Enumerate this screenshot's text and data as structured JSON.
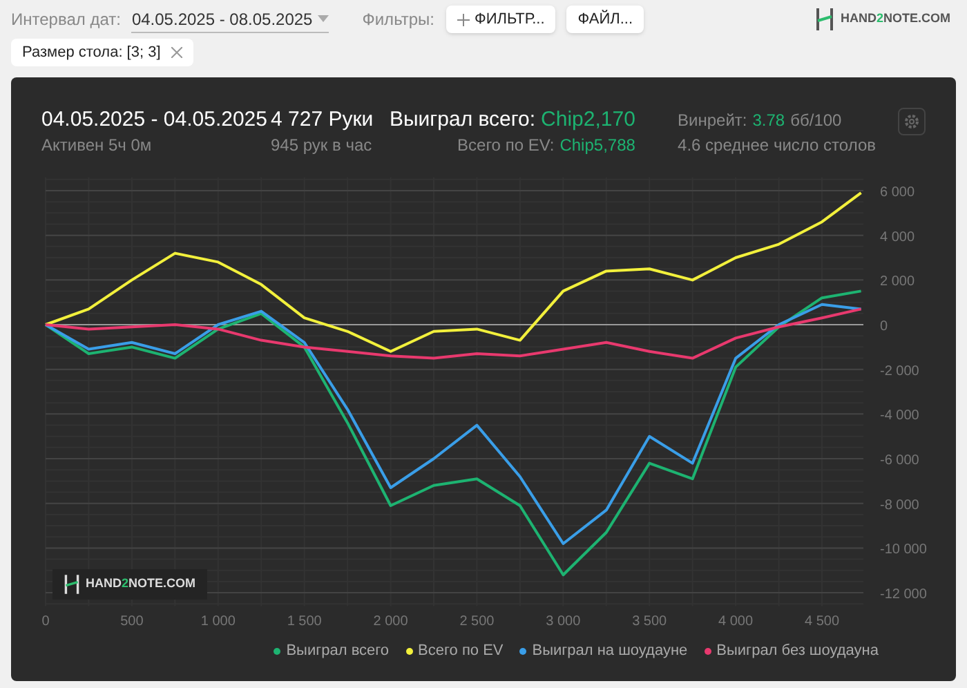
{
  "toolbar": {
    "date_label": "Интервал дат:",
    "date_value": "04.05.2025 - 08.05.2025",
    "filters_label": "Фильтры:",
    "filter_button": "ФИЛЬТР...",
    "file_button": "ФАЙЛ...",
    "logo": {
      "prefix": "HAND",
      "accent": "2",
      "suffix": "NOTE.COM"
    }
  },
  "active_filters": [
    {
      "label": "Размер стола: [3; 3]"
    }
  ],
  "summary": {
    "period": "04.05.2025 - 04.05.2025",
    "active": "Активен 5ч 0м",
    "hands": "4 727 Руки",
    "hands_per_hour": "945 рук в час",
    "won_label": "Выиграл всего:",
    "won_value": "Chip2,170",
    "ev_label": "Всего по EV:",
    "ev_value": "Chip5,788",
    "winrate_label": "Винрейт:",
    "winrate_value": "3.78",
    "winrate_unit": "бб/100",
    "tables": "4.6 среднее число столов"
  },
  "chart": {
    "logo": {
      "prefix": "HAND",
      "accent": "2",
      "suffix": "NOTE.COM"
    },
    "chart_data": {
      "type": "line",
      "x": [
        0,
        250,
        500,
        750,
        1000,
        1250,
        1500,
        1750,
        2000,
        2250,
        2500,
        2750,
        3000,
        3250,
        3500,
        3750,
        4000,
        4250,
        4500,
        4727
      ],
      "series": [
        {
          "name": "Выиграл всего",
          "color": "#1db371",
          "values": [
            0,
            -1300,
            -1000,
            -1500,
            -200,
            500,
            -1000,
            -4400,
            -8100,
            -7200,
            -6900,
            -8100,
            -11200,
            -9300,
            -6200,
            -6900,
            -1900,
            -100,
            1200,
            1500
          ]
        },
        {
          "name": "Всего по EV",
          "color": "#f2f03c",
          "values": [
            0,
            700,
            2000,
            3200,
            2800,
            1800,
            300,
            -300,
            -1200,
            -300,
            -200,
            -700,
            1500,
            2400,
            2500,
            2000,
            3000,
            3600,
            4600,
            5900
          ]
        },
        {
          "name": "Выиграл на шоудауне",
          "color": "#3a9ee8",
          "values": [
            0,
            -1100,
            -800,
            -1300,
            0,
            600,
            -800,
            -3800,
            -7300,
            -6000,
            -4500,
            -6800,
            -9800,
            -8300,
            -5000,
            -6200,
            -1500,
            0,
            900,
            700
          ]
        },
        {
          "name": "Выиграл без шоудауна",
          "color": "#e8396e",
          "values": [
            0,
            -200,
            -100,
            0,
            -200,
            -700,
            -1000,
            -1200,
            -1400,
            -1500,
            -1300,
            -1400,
            -1100,
            -800,
            -1200,
            -1500,
            -600,
            -100,
            300,
            700
          ]
        }
      ],
      "grid": true,
      "xlim": [
        0,
        4727
      ],
      "ylim": [
        -12600,
        6600
      ],
      "xticks": [
        0,
        500,
        {
          "value": 1000,
          "label": "1 000"
        },
        {
          "value": 1500,
          "label": "1 500"
        },
        {
          "value": 2000,
          "label": "2 000"
        },
        {
          "value": 2500,
          "label": "2 500"
        },
        {
          "value": 3000,
          "label": "3 000"
        },
        {
          "value": 3500,
          "label": "3 500"
        },
        {
          "value": 4000,
          "label": "4 000"
        },
        {
          "value": 4500,
          "label": "4 500"
        }
      ],
      "yticks": [
        {
          "value": 6000,
          "label": "6 000"
        },
        {
          "value": 4000,
          "label": "4 000"
        },
        {
          "value": 2000,
          "label": "2 000"
        },
        0,
        {
          "value": -2000,
          "label": "-2 000"
        },
        {
          "value": -4000,
          "label": "-4 000"
        },
        {
          "value": -6000,
          "label": "-6 000"
        },
        {
          "value": -8000,
          "label": "-8 000"
        },
        {
          "value": -10000,
          "label": "-10 000"
        },
        {
          "value": -12000,
          "label": "-12 000"
        }
      ]
    }
  }
}
